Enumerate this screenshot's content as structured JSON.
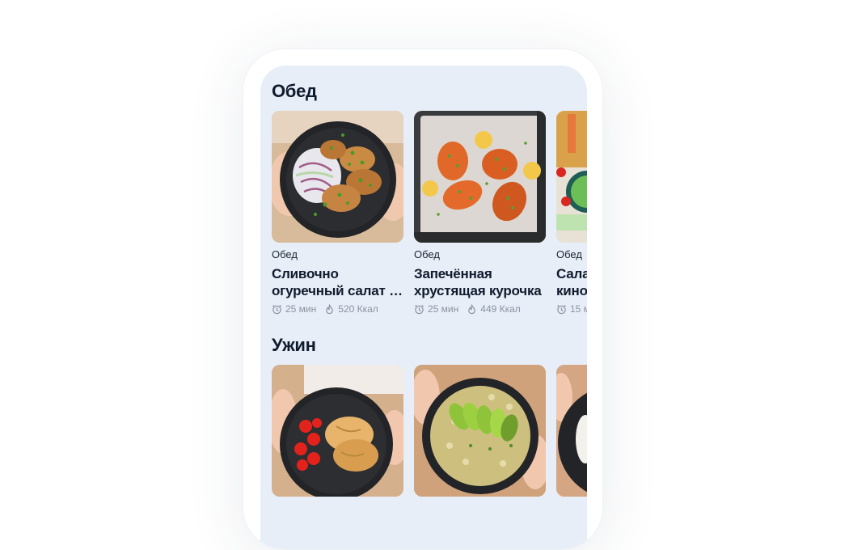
{
  "sections": [
    {
      "title": "Обед",
      "recipes": [
        {
          "category": "Обед",
          "name_line1": "Сливочно",
          "name_line2": "огуречный салат с…",
          "time": "25 мин",
          "kcal": "520 Ккал",
          "image": "cucumber-salad-cutlets-photo"
        },
        {
          "category": "Обед",
          "name_line1": "Запечённая",
          "name_line2": "хрустящая курочка",
          "time": "25 мин",
          "kcal": "449 Ккал",
          "image": "baked-chicken-photo"
        },
        {
          "category": "Обед",
          "name_line1": "Сала",
          "name_line2": "кино",
          "time": "15 м",
          "kcal": "",
          "image": "quinoa-salad-photo"
        }
      ]
    },
    {
      "title": "Ужин",
      "recipes": [
        {
          "image": "chicken-tomatoes-photo"
        },
        {
          "image": "avocado-bowl-photo"
        },
        {
          "image": "rice-dish-photo"
        }
      ]
    }
  ],
  "icons": {
    "time": "alarm-clock-icon",
    "calories": "flame-icon"
  },
  "colors": {
    "screen_bg": "#e8eef7",
    "title": "#0f1b2d",
    "meta": "#8a93a3"
  }
}
